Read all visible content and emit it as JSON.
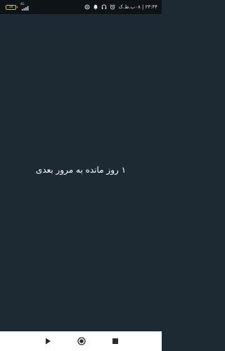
{
  "status_bar": {
    "battery_level": "38",
    "signal_label": "4G",
    "time_text": "۲۳:۴۴ | ۰۸ب.ظ.ک",
    "icons": [
      "alarm-icon",
      "headphones-icon",
      "notification-icon",
      "circle-icon"
    ]
  },
  "main": {
    "message": "۱ روز مانده به مرور بعدی"
  },
  "nav_bar": {
    "buttons": [
      "back-icon",
      "home-icon",
      "recents-icon"
    ]
  },
  "colors": {
    "background": "#1e2a33",
    "status_bar": "#0d1317",
    "nav_bar": "#ffffff",
    "battery": "#e0c33a",
    "text": "#ffffff"
  }
}
